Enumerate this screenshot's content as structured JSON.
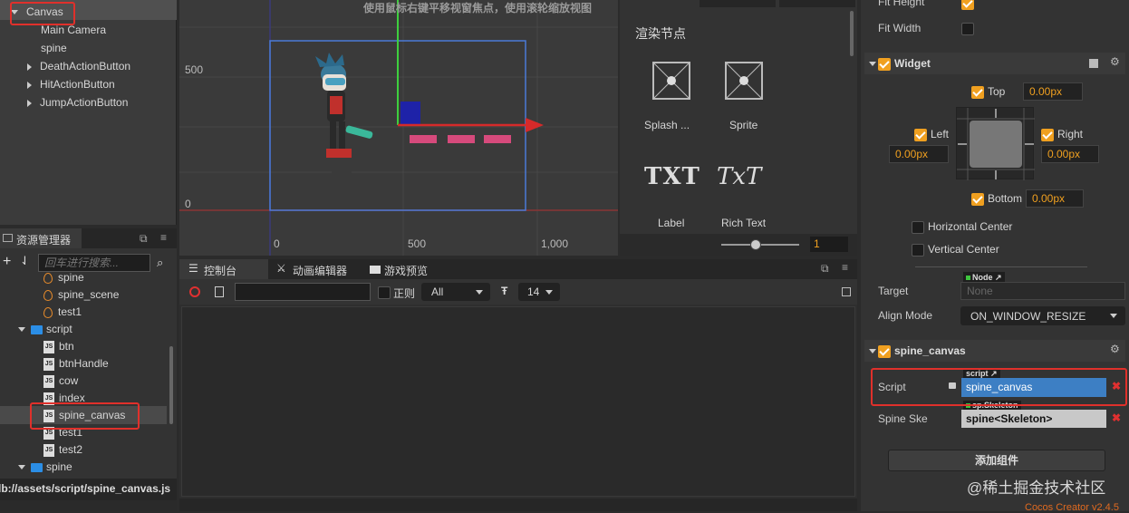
{
  "hierarchy": {
    "items": [
      {
        "label": "Canvas",
        "indent": 0,
        "expand": "down"
      },
      {
        "label": "Main Camera",
        "indent": 1,
        "expand": ""
      },
      {
        "label": "spine",
        "indent": 1,
        "expand": ""
      },
      {
        "label": "DeathActionButton",
        "indent": 1,
        "expand": "right"
      },
      {
        "label": "HitActionButton",
        "indent": 1,
        "expand": "right"
      },
      {
        "label": "JumpActionButton",
        "indent": 1,
        "expand": "right"
      }
    ]
  },
  "scene": {
    "hint": "使用鼠标右键平移视窗焦点，使用滚轮缩放视图",
    "y_labels": [
      "500",
      "0"
    ],
    "x_labels": [
      "0",
      "500",
      "1,000"
    ]
  },
  "node_library": {
    "title": "渲染节点",
    "items": [
      "Splash ...",
      "Sprite",
      "Label",
      "Rich Text"
    ],
    "zoom_value": "1",
    "label_glyph": "TXT",
    "richtext_glyph": "TxT"
  },
  "assets": {
    "title": "资源管理器",
    "search_placeholder": "回车进行搜索...",
    "items": [
      {
        "label": "spine",
        "type": "flame",
        "indent": 2
      },
      {
        "label": "spine_scene",
        "type": "flame",
        "indent": 2
      },
      {
        "label": "test1",
        "type": "flame",
        "indent": 2
      },
      {
        "label": "script",
        "type": "folder",
        "indent": 1
      },
      {
        "label": "btn",
        "type": "js",
        "indent": 2
      },
      {
        "label": "btnHandle",
        "type": "js",
        "indent": 2
      },
      {
        "label": "cow",
        "type": "js",
        "indent": 2
      },
      {
        "label": "index",
        "type": "js",
        "indent": 2
      },
      {
        "label": "spine_canvas",
        "type": "js",
        "indent": 2
      },
      {
        "label": "test1",
        "type": "js",
        "indent": 2
      },
      {
        "label": "test2",
        "type": "js",
        "indent": 2
      },
      {
        "label": "spine",
        "type": "folder",
        "indent": 1
      }
    ],
    "status_path": "db://assets/script/spine_canvas.js"
  },
  "console": {
    "tabs": [
      "控制台",
      "动画编辑器",
      "游戏预览"
    ],
    "regex_label": "正则",
    "filter_value": "All",
    "font_size": "14"
  },
  "inspector": {
    "fit_height_label": "Fit Height",
    "fit_width_label": "Fit Width",
    "widget_title": "Widget",
    "top_label": "Top",
    "top_value": "0.00px",
    "left_label": "Left",
    "left_value": "0.00px",
    "right_label": "Right",
    "right_value": "0.00px",
    "bottom_label": "Bottom",
    "bottom_value": "0.00px",
    "horizontal_center_label": "Horizontal Center",
    "vertical_center_label": "Vertical Center",
    "target_label": "Target",
    "target_tag": "Node",
    "target_value": "None",
    "align_mode_label": "Align Mode",
    "align_mode_value": "ON_WINDOW_RESIZE",
    "component_title": "spine_canvas",
    "script_label": "Script",
    "script_tag": "script",
    "script_value": "spine_canvas",
    "spine_label": "Spine Ske",
    "spine_tag": "sp.Skeleton",
    "spine_value": "spine<Skeleton>",
    "add_component_label": "添加组件"
  },
  "footer": {
    "watermark": "@稀土掘金技术社区",
    "version": "Cocos Creator v2.4.5"
  },
  "colors": {
    "accent": "#f0a020",
    "highlight": "#e0302b",
    "selected": "#3d7fc4"
  }
}
